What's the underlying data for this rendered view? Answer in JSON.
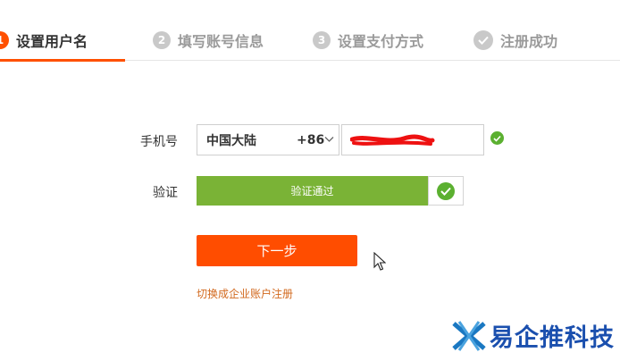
{
  "steps": [
    {
      "number": "1",
      "label": "设置用户名",
      "state": "active"
    },
    {
      "number": "2",
      "label": "填写账号信息",
      "state": "pending"
    },
    {
      "number": "3",
      "label": "设置支付方式",
      "state": "pending"
    },
    {
      "number": "",
      "label": "注册成功",
      "state": "pending",
      "icon": "check-icon"
    }
  ],
  "form": {
    "phone_label": "手机号",
    "country_name": "中国大陆",
    "country_code": "+86",
    "phone_value": "",
    "verify_label": "验证",
    "verify_status": "验证通过",
    "next_label": "下一步",
    "switch_link": "切换成企业账户注册"
  },
  "watermark": {
    "text": "易企推科技",
    "icon": "logo-icon"
  },
  "colors": {
    "accent": "#ff5000",
    "success": "#7ab336",
    "link": "#d2691e",
    "watermark": "#1a4fae"
  }
}
